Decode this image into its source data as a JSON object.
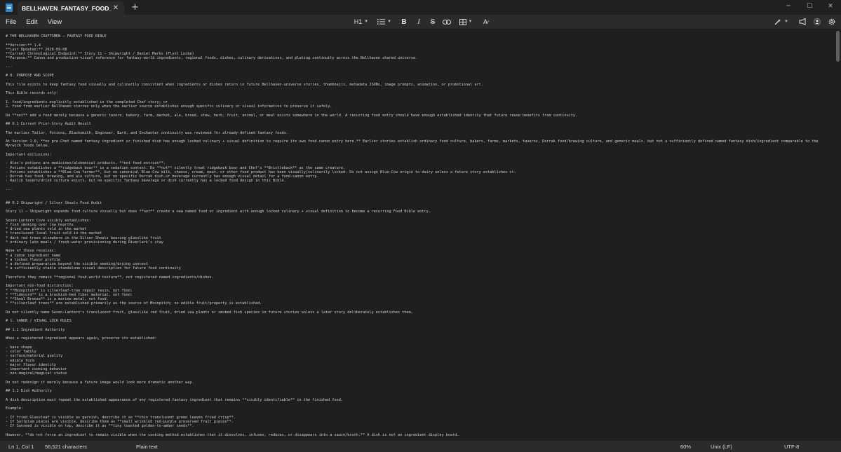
{
  "window": {
    "tab_title": "BELLHAVEN_FANTASY_FOOD_BIBLE",
    "close_tab_glyph": "✕",
    "new_tab_glyph": "+",
    "minimize_glyph": "─",
    "maximize_glyph": "☐",
    "close_glyph": "✕"
  },
  "menu": {
    "file": "File",
    "edit": "Edit",
    "view": "View"
  },
  "toolbar": {
    "heading": "H1",
    "bold": "B",
    "italic": "I",
    "strike": "S",
    "icons": [
      "list-icon",
      "link-icon",
      "table-icon",
      "clear-format-icon",
      "copilot-icon",
      "share-icon",
      "profile-icon",
      "settings-icon"
    ]
  },
  "document": {
    "content": "# THE BELLHAVEN CRAFTSMEN — FANTASY FOOD BIBLE\n\n**Version:** 1.4\n**Last Updated:** 2026-09-08\n**Current Chronological Endpoint:** Story 11 — Shipwright / Daniel Marks (Flynt Locke)\n**Purpose:** Canon and production-visual reference for fantasy-world ingredients, regional foods, dishes, culinary derivatives, and plating continuity across the Bellhaven shared universe.\n\n---\n\n# 0. PURPOSE AND SCOPE\n\nThis file exists to keep fantasy food visually and culinarily consistent when ingredients or dishes return in future Bellhaven-universe stories, thumbnails, metadata JSONs, image prompts, animation, or promotional art.\n\nThis Bible records only:\n\n1. food/ingredients explicitly established in the completed Chef story; or\n2. food from earlier Bellhaven stories only when the earlier source establishes enough specific culinary or visual information to preserve it safely.\n\nDo **not** add a food merely because a generic tavern, bakery, farm, market, ale, bread, stew, herb, fruit, animal, or meal exists somewhere in the world. A recurring food entry should have enough established identity that future reuse benefits from continuity.\n\n## 0.1 Current Prior-Story Audit Result\n\nThe earlier Tailor, Potions, Blacksmith, Engineer, Bard, and Enchanter continuity was reviewed for already-defined fantasy foods.\n\nAt Version 1.0, **no pre-Chef named fantasy ingredient or finished dish has enough locked culinary + visual definition to require its own food-canon entry here.** Earlier stories establish ordinary food culture, bakers, farms, markets, taverns, Dorrak food/brewing culture, and generic meals, but not a sufficiently defined named fantasy dish/ingredient comparable to the Myrwick foods below.\n\nImportant exclusions:\n\n- Alex's potions are medicines/alchemical products, **not food entries**.\n- Potions establishes a **ridgeback boar** in a sedation context. Do **not** silently treat ridgeback boar and Chef's **Bristleback** as the same creature.\n- Potions establishes a **Blue-Cow farmer**, but no canonical Blue-Cow milk, cheese, cream, meat, or other food product has been visually/culinarily locked. Do not assign Blue-Cow origin to dairy unless a future story establishes it.\n- Dorrak has food, brewing, and ale culture, but no specific Dorrak dish or beverage currently has enough visual detail for a food-canon entry.\n- Ravlin tavern/drink culture exists, but no specific fantasy beverage or dish currently has a locked food design in this Bible.\n\n---\n\n\n## 0.2 Shipwright / Silver Shoals Food Audit\n\nStory 11 — Shipwright expands food culture visually but does **not** create a new named food or ingredient with enough locked culinary + visual definition to become a recurring Food Bible entry.\n\nSeven-Lantern Cove visibly establishes:\n* fish smoking over low hearths\n* dried sea plants sold in the market\n* translucent local fruit sold in the market\n* dark red trees elsewhere in the Silver Shoals bearing glasslike fruit\n* ordinary late meals / fresh-water provisioning during Riverlark's stay\n\nNone of these receives:\n* a canon ingredient name\n* a locked flavor profile\n* a defined preparation beyond the visible smoking/drying context\n* a sufficiently stable standalone visual description for future food continuity\n\nTherefore they remain **regional food-world texture**, not registered named ingredients/dishes.\n\nImportant non-food distinction:\n* **Moonpitch** is silverleaf-tree repair resin, not food.\n* **Tidecord** is a brackish-bed fiber material, not food.\n* **Shoal Bronze** is a marine metal, not food.\n* **silverleaf trees** are established primarily as the source of Moonpitch; no edible fruit/property is established.\n\nDo not silently name Seven-Lantern's translucent fruit, glasslike red fruit, dried sea plants or smoked fish species in future stories unless a later story deliberately establishes them.\n\n# 1. CANON / VISUAL LOCK RULES\n\n## 1.1 Ingredient Authority\n\nWhen a registered ingredient appears again, preserve its established:\n\n- base shape\n- color family\n- surface/material quality\n- edible form\n- major flavor identity\n- important cooking behavior\n- non-magical/magical status\n\nDo not redesign it merely because a future image would look more dramatic another way.\n\n## 1.2 Dish Authority\n\nA dish description must repeat the established appearance of any registered fantasy ingredient that remains **visibly identifiable** in the finished food.\n\nExample:\n\n- If fried Glassleaf is visible as garnish, describe it as **thin translucent green leaves fried crisp**.\n- If Saltplum pieces are visible, describe them as **small wrinkled red-purple preserved fruit pieces**.\n- If Sunseed is visible on top, describe it as **tiny toasted golden-to-amber seeds**.\n\nHowever, **do not force an ingredient to remain visible when the cooking method establishes that it dissolves, infuses, reduces, or disappears into a sauce/broth.** A dish is not an ingredient display board."
  },
  "status": {
    "position": "Ln 1, Col 1",
    "characters": "56,521 characters",
    "format": "Plain text",
    "zoom": "60%",
    "line_endings": "Unix (LF)",
    "encoding": "UTF-8"
  },
  "colors": {
    "background": "#1f1f1f",
    "chrome": "#2b2b2b",
    "text": "#cfcfcf",
    "accent": "#2b87d1"
  }
}
